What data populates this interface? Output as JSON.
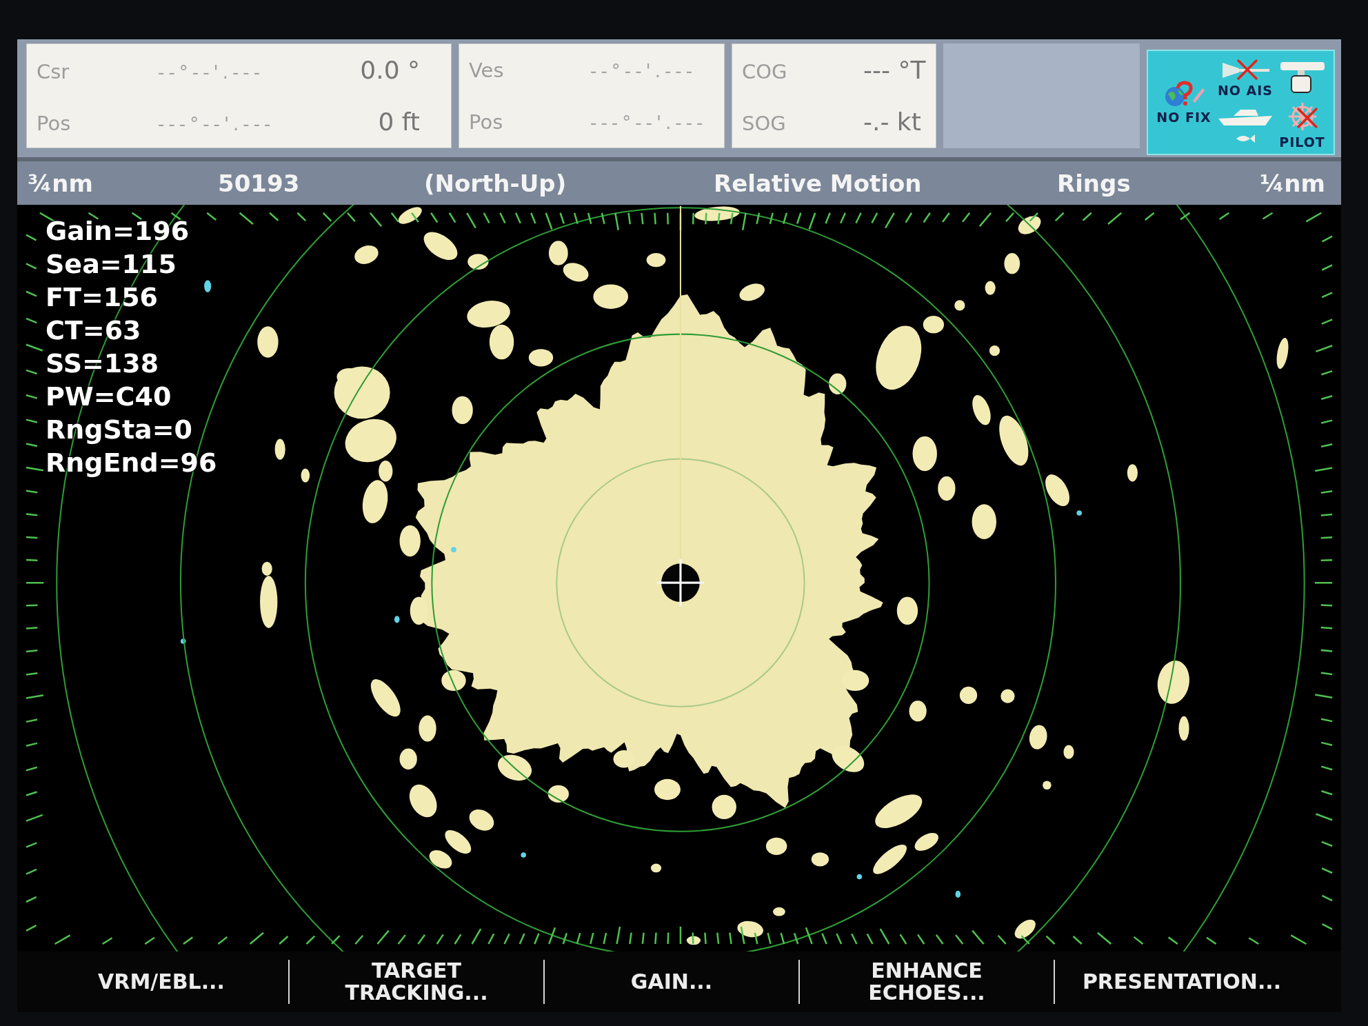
{
  "data_boxes": [
    {
      "rows": [
        {
          "label": "Csr",
          "coordinate": "--°--'.---",
          "reading": "0.0 °"
        },
        {
          "label": "Pos",
          "coordinate": "---°--'.---",
          "reading": "0 ft"
        }
      ]
    },
    {
      "rows": [
        {
          "label": "Ves",
          "coordinate": "--°--'.---"
        },
        {
          "label": "Pos",
          "coordinate": "---°--'.---"
        }
      ]
    },
    {
      "rows": [
        {
          "label": "COG",
          "reading": "--- °T"
        },
        {
          "label": "SOG",
          "reading": "-.- kt"
        }
      ]
    }
  ],
  "status_panel": {
    "indicators": [
      {
        "kind": "gps",
        "label": "NO FIX",
        "crossed": false
      },
      {
        "kind": "ais",
        "label": "NO AIS",
        "crossed": true
      },
      {
        "kind": "pilot",
        "label": "PILOT",
        "crossed": true
      }
    ]
  },
  "header": [
    "¾nm",
    "50193",
    "(North-Up)",
    "Relative Motion",
    "Rings",
    "¼nm"
  ],
  "readouts": [
    "Gain=196",
    "Sea=115",
    "FT=156",
    "CT=63",
    "SS=138",
    "PW=C40",
    "RngSta=0",
    "RngEnd=96"
  ],
  "softkeys": [
    "VRM/EBL...",
    "TARGET\nTRACKING...",
    "GAIN...",
    "ENHANCE\nECHOES...",
    "PRESENTATION..."
  ]
}
